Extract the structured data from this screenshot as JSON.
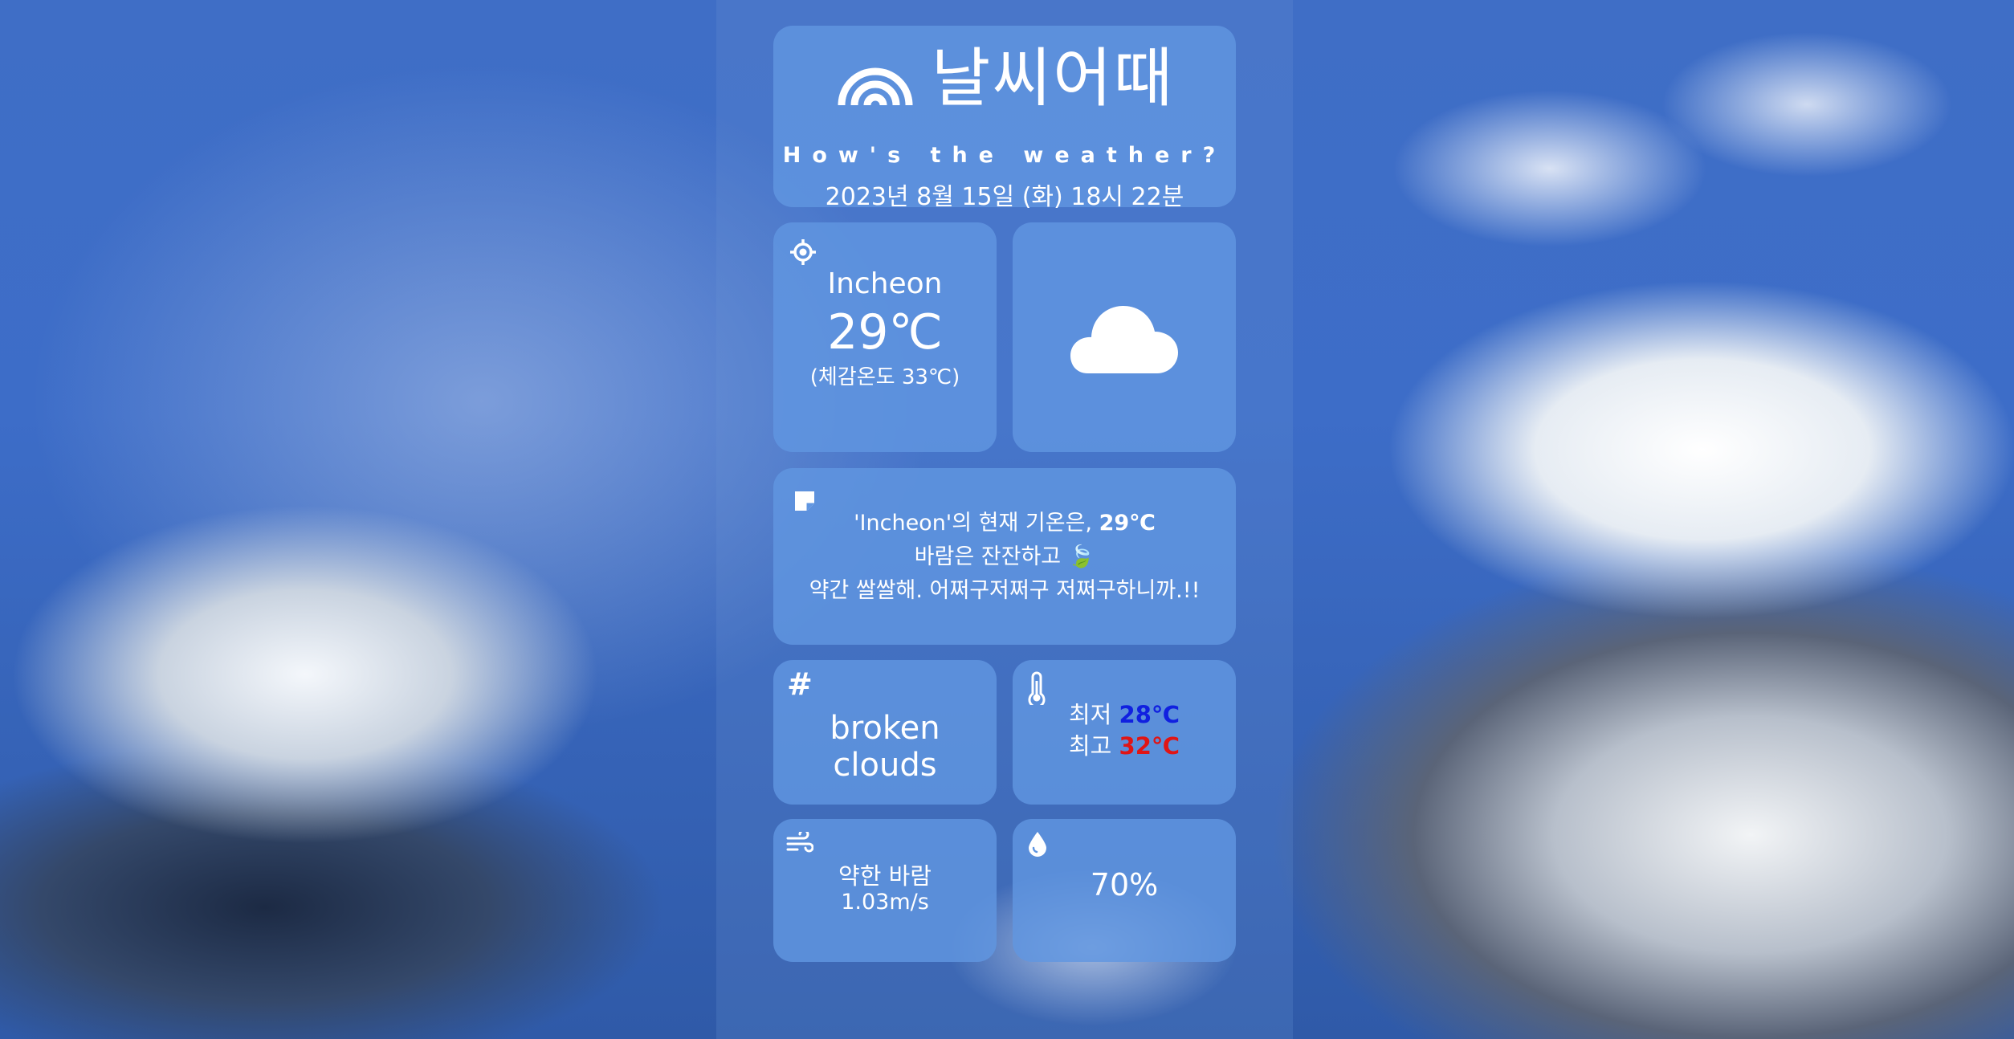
{
  "app": {
    "title": "날씨어때",
    "subtitle": "How's the weather?",
    "datetime": "2023년 8월 15일 (화) 18시 22분"
  },
  "location": {
    "city": "Incheon",
    "temperature": "29℃",
    "feels_like": "(체감온도 33℃)",
    "icon": "location-crosshair-icon"
  },
  "condition": {
    "icon": "cloud-icon"
  },
  "message": {
    "line1_prefix": "'Incheon'의 현재 기온은, ",
    "line1_temp": "29℃",
    "line2": "바람은 잔잔하고 🍃",
    "line3": "약간 쌀쌀해. 어쩌구저쩌구 저쩌구하니까.!!",
    "icon": "sticky-note-icon"
  },
  "description": {
    "text": "broken clouds",
    "icon": "hash-icon",
    "hash_symbol": "#"
  },
  "min_max": {
    "min_label": "최저",
    "min_value": "28℃",
    "max_label": "최고",
    "max_value": "32℃",
    "min_color": "#1020e0",
    "max_color": "#e01515",
    "icon": "thermometer-icon"
  },
  "wind": {
    "label": "약한 바람",
    "speed": "1.03m/s",
    "icon": "wind-icon"
  },
  "humidity": {
    "value": "70%",
    "icon": "droplet-icon"
  },
  "colors": {
    "card": "#6096e1",
    "sky": "#3f6ec6"
  }
}
